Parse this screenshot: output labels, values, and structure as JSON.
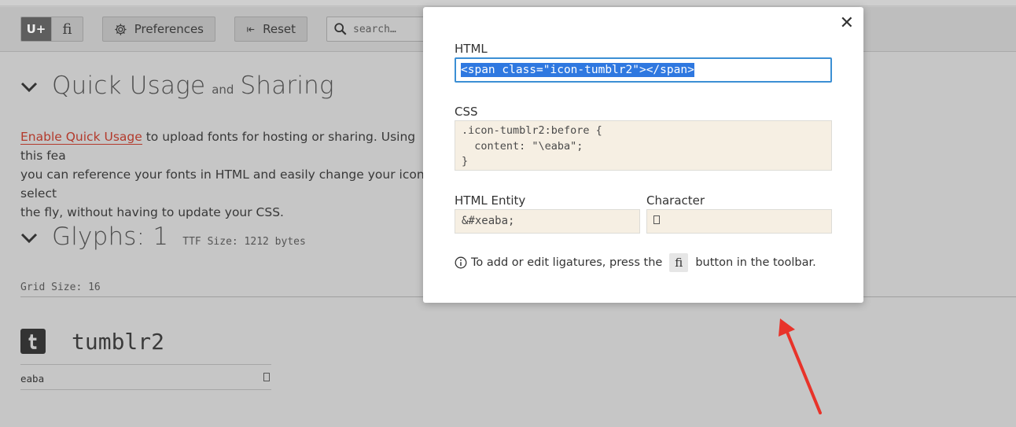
{
  "toolbar": {
    "unicode_toggle": "U+",
    "ligature_toggle": "ﬁ",
    "preferences_label": "Preferences",
    "reset_label": "Reset",
    "search_placeholder": "search…"
  },
  "quick_usage": {
    "title_a": "Quick Usage",
    "title_and": "and",
    "title_b": "Sharing",
    "link_text": "Enable Quick Usage",
    "line1_rest": " to upload fonts for hosting or sharing. Using this fea",
    "line2": "you can reference your fonts in HTML and easily change your icon select",
    "line3": "the fly, without having to update your CSS."
  },
  "glyphs": {
    "title": "Glyphs: 1",
    "ttf_size": "TTF Size: 1212 bytes",
    "grid_size": "Grid Size: 16",
    "items": [
      {
        "name": "tumblr2",
        "code": "eaba"
      }
    ]
  },
  "modal": {
    "html_label": "HTML",
    "html_value": "<span class=\"icon-tumblr2\"></span>",
    "css_label": "CSS",
    "css_value": ".icon-tumblr2:before {\n  content: \"\\eaba\";\n}",
    "entity_label": "HTML Entity",
    "entity_value": "&#xeaba;",
    "character_label": "Character",
    "note_before": "To add or edit ligatures, press the",
    "note_button": "ﬁ",
    "note_after": "button in the toolbar."
  },
  "colors": {
    "accent_blue": "#3c8fd4",
    "selection_blue": "#2f78e0",
    "link_red": "#b33a2c",
    "code_bg": "#f6efe3",
    "arrow_red": "#e8332a"
  }
}
